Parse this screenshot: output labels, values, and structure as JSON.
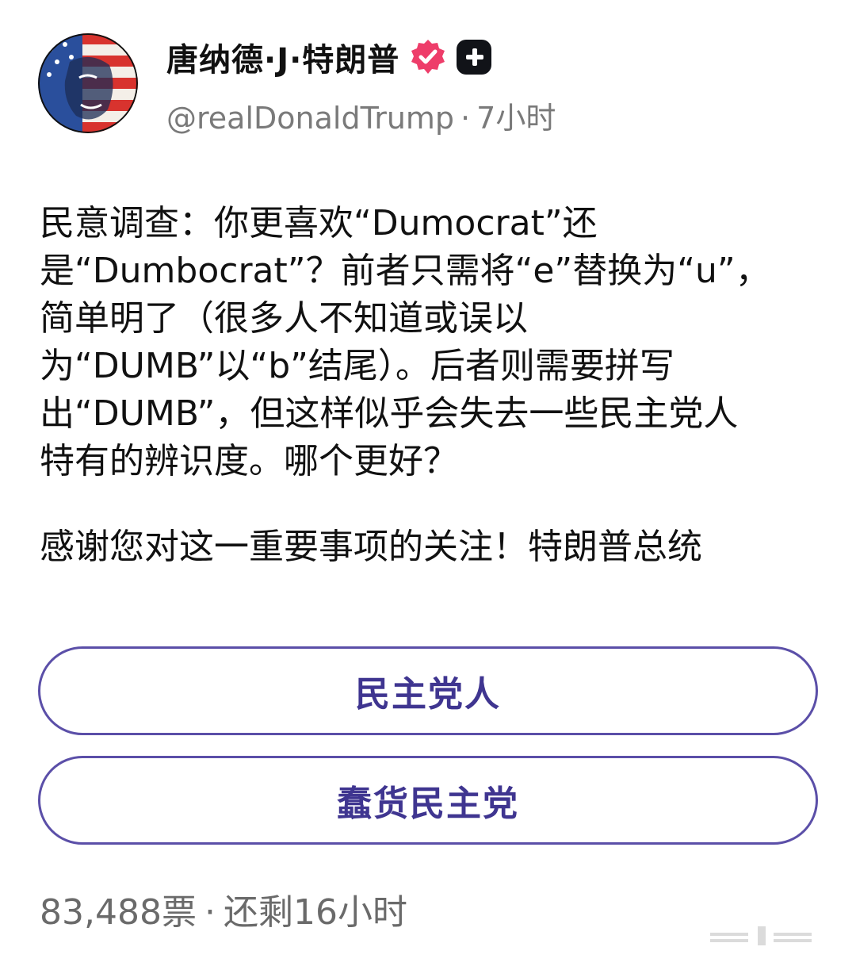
{
  "author": {
    "display_name": "唐纳德·J·特朗普",
    "handle": "@realDonaldTrump",
    "separator": "·",
    "time_ago": "7小时",
    "avatar_icon": "avatar-flag-portrait-icon",
    "verified_icon": "verified-badge-icon",
    "plus_icon": "plus-icon"
  },
  "post": {
    "lines": [
      "民意调查：你更喜欢“Dumocrat”还",
      "是“Dumbocrat”？前者只需将“e”替换为“u”，",
      "简单明了（很多人不知道或误以",
      "为“DUMB”以“b”结尾）。后者则需要拼写",
      "出“DUMB”，但这样似乎会失去一些民主党人",
      "特有的辨识度。哪个更好？"
    ],
    "closing": "感谢您对这一重要事项的关注！特朗普总统"
  },
  "poll": {
    "options": [
      {
        "label": "民主党人"
      },
      {
        "label": "蠢货民主党"
      }
    ],
    "votes": "83,488票",
    "separator": "·",
    "time_left": "还剩16小时"
  },
  "colors": {
    "accent": "#5b4fa8",
    "option_text": "#3f3590",
    "verified_badge": "#ee3d6a",
    "muted_text": "#7a7a7a"
  }
}
